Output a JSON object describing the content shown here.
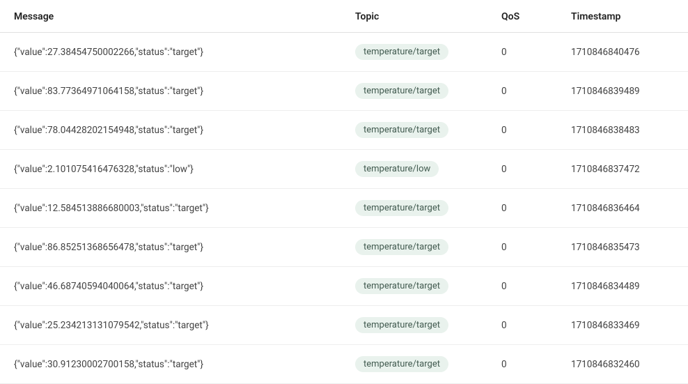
{
  "columns": {
    "message": "Message",
    "topic": "Topic",
    "qos": "QoS",
    "timestamp": "Timestamp"
  },
  "rows": [
    {
      "message": "{\"value\":27.38454750002266,\"status\":\"target\"}",
      "topic": "temperature/target",
      "qos": "0",
      "timestamp": "1710846840476"
    },
    {
      "message": "{\"value\":83.77364971064158,\"status\":\"target\"}",
      "topic": "temperature/target",
      "qos": "0",
      "timestamp": "1710846839489"
    },
    {
      "message": "{\"value\":78.04428202154948,\"status\":\"target\"}",
      "topic": "temperature/target",
      "qos": "0",
      "timestamp": "1710846838483"
    },
    {
      "message": "{\"value\":2.101075416476328,\"status\":\"low\"}",
      "topic": "temperature/low",
      "qos": "0",
      "timestamp": "1710846837472"
    },
    {
      "message": "{\"value\":12.584513886680003,\"status\":\"target\"}",
      "topic": "temperature/target",
      "qos": "0",
      "timestamp": "1710846836464"
    },
    {
      "message": "{\"value\":86.85251368656478,\"status\":\"target\"}",
      "topic": "temperature/target",
      "qos": "0",
      "timestamp": "1710846835473"
    },
    {
      "message": "{\"value\":46.68740594040064,\"status\":\"target\"}",
      "topic": "temperature/target",
      "qos": "0",
      "timestamp": "1710846834489"
    },
    {
      "message": "{\"value\":25.234213131079542,\"status\":\"target\"}",
      "topic": "temperature/target",
      "qos": "0",
      "timestamp": "1710846833469"
    },
    {
      "message": "{\"value\":30.91230002700158,\"status\":\"target\"}",
      "topic": "temperature/target",
      "qos": "0",
      "timestamp": "1710846832460"
    }
  ]
}
